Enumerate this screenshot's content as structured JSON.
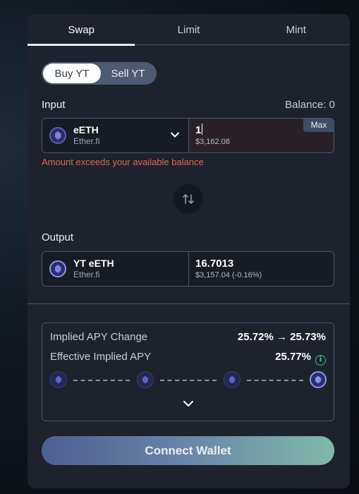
{
  "tabs": [
    {
      "label": "Swap",
      "active": true
    },
    {
      "label": "Limit",
      "active": false
    },
    {
      "label": "Mint",
      "active": false
    }
  ],
  "mode_toggle": {
    "buy_label": "Buy YT",
    "sell_label": "Sell YT",
    "selected": "Buy YT"
  },
  "input": {
    "label": "Input",
    "balance_text": "Balance: 0",
    "token_name": "eETH",
    "token_source": "Ether.fi",
    "amount": "1",
    "amount_usd": "$3,162.08",
    "max_label": "Max",
    "error": "Amount exceeds your available balance"
  },
  "output": {
    "label": "Output",
    "token_name": "YT eETH",
    "token_source": "Ether.fi",
    "amount": "16.7013",
    "amount_usd": "$3,157.04 (-0.16%)"
  },
  "details": {
    "implied_apy_change_label": "Implied APY Change",
    "implied_apy_change_value": "25.72% → 25.73%",
    "effective_apy_label": "Effective Implied APY",
    "effective_apy_value": "25.77%"
  },
  "connect_button": "Connect Wallet",
  "icons": {
    "token": "ether-fi-token-icon",
    "swap": "swap-arrows-icon",
    "info": "info-icon",
    "expand": "chevron-down-icon"
  },
  "colors": {
    "error": "#e0665d",
    "accent_green": "#4fc18a",
    "card_bg": "#1d222c"
  }
}
